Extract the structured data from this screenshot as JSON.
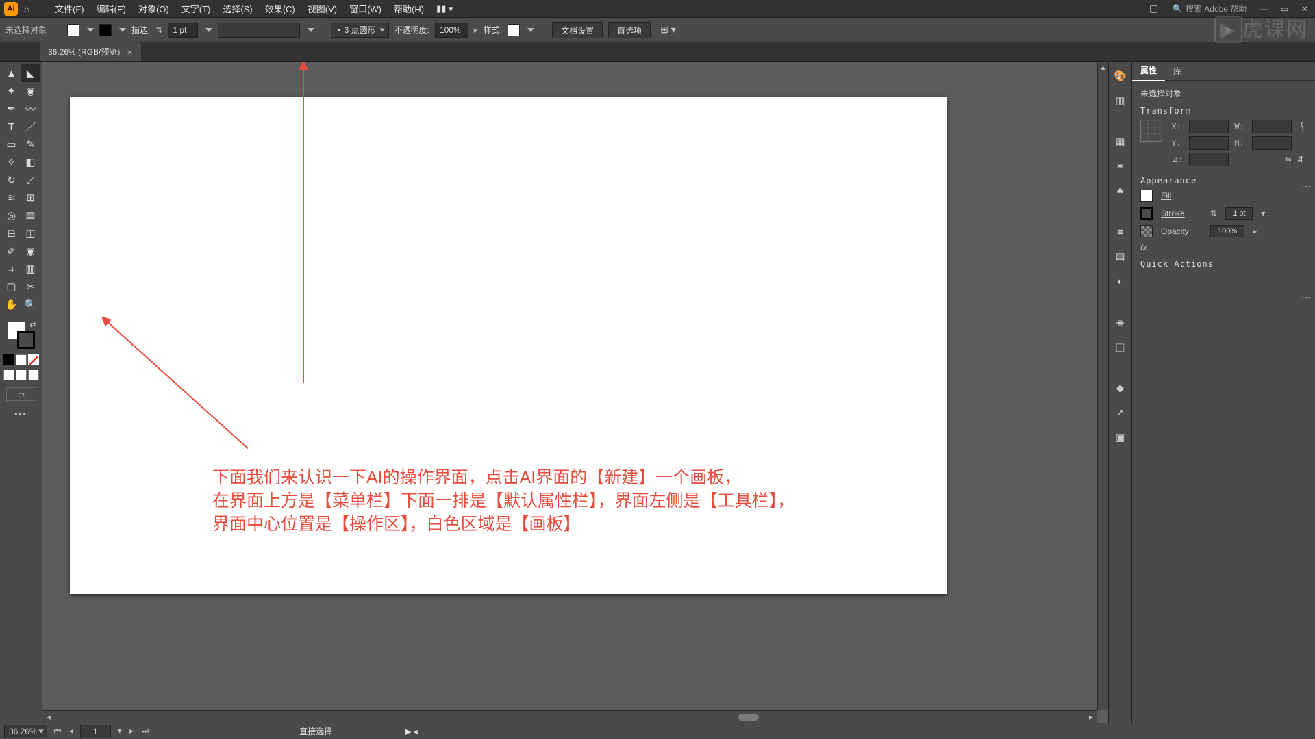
{
  "menubar": {
    "app_abbrev": "Ai",
    "items": [
      "文件(F)",
      "编辑(E)",
      "对象(O)",
      "文字(T)",
      "选择(S)",
      "效果(C)",
      "视图(V)",
      "窗口(W)",
      "帮助(H)"
    ],
    "search_placeholder": "搜索 Adobe 帮助"
  },
  "controlbar": {
    "no_selection": "未选择对象",
    "stroke_label": "描边:",
    "stroke_value": "1 pt",
    "dashed_label": "3 点圆形",
    "opacity_label": "不透明度:",
    "opacity_value": "100%",
    "style_label": "样式:",
    "doc_setup": "文档设置",
    "prefs": "首选项"
  },
  "doc_tab": {
    "label": "36.26% (RGB/预览)",
    "close": "×"
  },
  "annotations": {
    "line1": "下面我们来认识一下AI的操作界面，点击AI界面的【新建】一个画板，",
    "line2": "在界面上方是【菜单栏】下面一排是【默认属性栏】，界面左侧是【工具栏】，",
    "line3": "界面中心位置是【操作区】，白色区域是【画板】"
  },
  "dock_icons": [
    "palette",
    "page",
    "grid",
    "wand",
    "club",
    "lines",
    "window",
    "world",
    "layers",
    "swatches",
    "export",
    "artboards"
  ],
  "properties": {
    "tab_props": "属性",
    "tab_lib": "库",
    "no_sel": "未选择对象",
    "transform_title": "Transform",
    "X": "X:",
    "Y": "Y:",
    "W": "W:",
    "H": "H:",
    "angle_label": "⊿:",
    "appearance_title": "Appearance",
    "fill_label": "Fill",
    "stroke_label": "Stroke",
    "stroke_val": "1 pt",
    "opacity_label": "Opacity",
    "opacity_val": "100%",
    "fx_label": "fx.",
    "quick_actions": "Quick Actions"
  },
  "statusbar": {
    "zoom": "36.26%",
    "artboard_num": "1",
    "tool_hint": "直接选择"
  },
  "watermark": "虎课网"
}
